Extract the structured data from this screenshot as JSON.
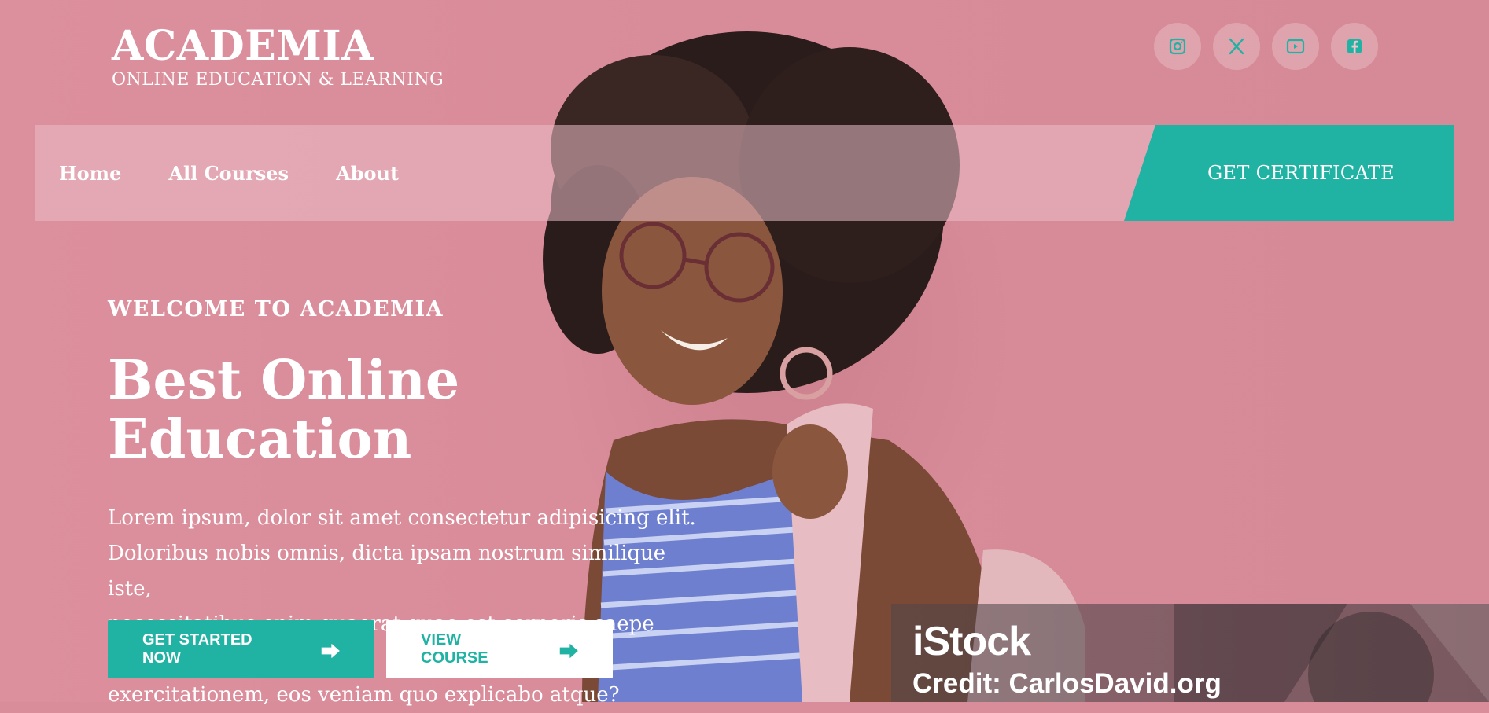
{
  "brand": {
    "title": "ACADEMIA",
    "tagline": "ONLINE EDUCATION & LEARNING"
  },
  "socials": [
    {
      "icon": "instagram-icon"
    },
    {
      "icon": "x-twitter-icon"
    },
    {
      "icon": "youtube-icon"
    },
    {
      "icon": "facebook-icon"
    }
  ],
  "nav": {
    "items": [
      {
        "label": "Home"
      },
      {
        "label": "All Courses"
      },
      {
        "label": "About"
      }
    ],
    "cta_label": "GET CERTIFICATE"
  },
  "hero": {
    "welcome": "WELCOME TO ACADEMIA",
    "headline": "Best Online Education",
    "lorem_lines": [
      "Lorem ipsum, dolor sit amet consectetur adipisicing elit.",
      "Doloribus nobis omnis, dicta ipsam nostrum similique iste,",
      "necessitatibus enim quaerat quae est corporis saepe vitae",
      "exercitationem, eos veniam quo explicabo atque?"
    ],
    "primary_button": "GET STARTED NOW",
    "secondary_button": "VIEW COURSE",
    "arrow": "⮕"
  },
  "watermark": {
    "logo": "iStock",
    "credit": "Credit: CarlosDavid.org"
  },
  "colors": {
    "accent": "#20b2a3",
    "background": "#d98c99"
  }
}
